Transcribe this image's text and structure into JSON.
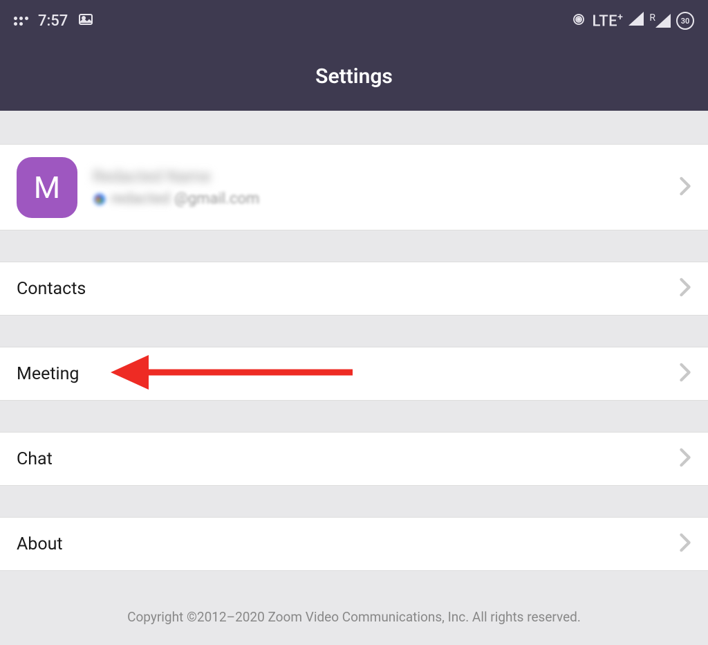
{
  "status": {
    "time": "7:57",
    "lte": "LTE",
    "lte_plus": "+",
    "roaming": "R",
    "battery": "30"
  },
  "header": {
    "title": "Settings"
  },
  "profile": {
    "avatar_letter": "M",
    "name": "Redacted Name",
    "email_user": "redacted",
    "email_domain": "@gmail.com"
  },
  "menu": {
    "contacts": "Contacts",
    "meeting": "Meeting",
    "chat": "Chat",
    "about": "About"
  },
  "footer": {
    "copyright": "Copyright ©2012–2020 Zoom Video Communications, Inc. All rights reserved."
  }
}
